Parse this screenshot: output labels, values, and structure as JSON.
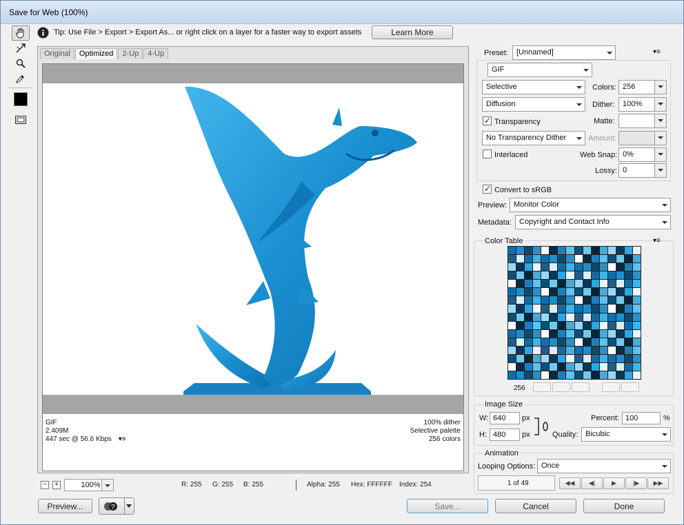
{
  "window": {
    "title": "Save for Web (100%)"
  },
  "tip": {
    "text": "Tip: Use File > Export > Export As...  or right click on a layer for a faster way to export assets",
    "learn_more": "Learn More"
  },
  "view_tabs": [
    "Original",
    "Optimized",
    "2-Up",
    "4-Up"
  ],
  "preview_info": {
    "format": "GIF",
    "size": "2.409M",
    "time": "447 sec @ 56.6 Kbps",
    "dither": "100% dither",
    "palette": "Selective palette",
    "colors": "256 colors"
  },
  "settings": {
    "preset_label": "Preset:",
    "preset_value": "[Unnamed]",
    "format": "GIF",
    "reduction": "Selective",
    "dither_algo": "Diffusion",
    "colors_label": "Colors:",
    "colors_value": "256",
    "dither_label": "Dither:",
    "dither_value": "100%",
    "transparency_label": "Transparency",
    "matte_label": "Matte:",
    "trans_dither": "No Transparency Dither",
    "amount_label": "Amount:",
    "interlaced_label": "Interlaced",
    "websnap_label": "Web Snap:",
    "websnap_value": "0%",
    "lossy_label": "Lossy:",
    "lossy_value": "0",
    "convert_label": "Convert to sRGB",
    "preview_label": "Preview:",
    "preview_value": "Monitor Color",
    "metadata_label": "Metadata:",
    "metadata_value": "Copyright and Contact Info"
  },
  "color_table": {
    "title": "Color Table",
    "count": "256"
  },
  "image_size": {
    "title": "Image Size",
    "w_label": "W:",
    "w_value": "640",
    "h_label": "H:",
    "h_value": "480",
    "unit": "px",
    "percent_label": "Percent:",
    "percent_value": "100",
    "percent_unit": "%",
    "quality_label": "Quality:",
    "quality_value": "Bicubic"
  },
  "animation": {
    "title": "Animation",
    "looping_label": "Looping Options:",
    "looping_value": "Once",
    "frame": "1 of 49"
  },
  "statusbar": {
    "zoom": "100%",
    "r": "R: 255",
    "g": "G: 255",
    "b": "B: 255",
    "alpha": "Alpha: 255",
    "hex": "Hex: FFFFFF",
    "index": "Index: 254"
  },
  "buttons": {
    "preview": "Preview...",
    "save": "Save...",
    "cancel": "Cancel",
    "done": "Done"
  },
  "colors": {
    "shark": "#1a8fd0",
    "accent": "#2b7fc4"
  }
}
